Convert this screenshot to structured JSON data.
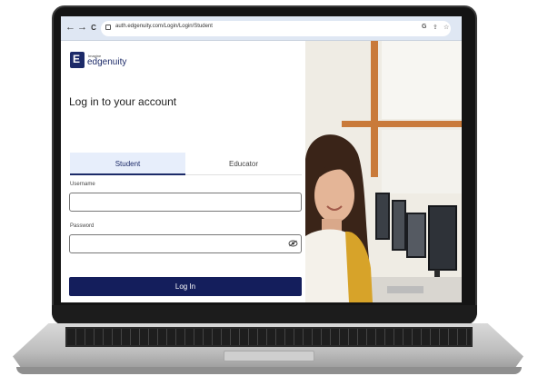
{
  "browser": {
    "url": "auth.edgenuity.com/Login/Login/Student",
    "nav_icons": [
      "back-arrow-icon",
      "forward-arrow-icon",
      "reload-icon"
    ],
    "right_icons": [
      "google-icon",
      "share-icon",
      "star-icon"
    ],
    "back_glyph": "←",
    "forward_glyph": "→",
    "reload_glyph": "C",
    "google_glyph": "G",
    "share_glyph": "⇪",
    "star_glyph": "☆"
  },
  "brand": {
    "small": "Imagine",
    "name": "edgenuity",
    "logo_letter": "E"
  },
  "login": {
    "title": "Log in to your account",
    "tabs": [
      "Student",
      "Educator"
    ],
    "selected_tab": "Student",
    "username_label": "Username",
    "username_value": "",
    "password_label": "Password",
    "password_value": "",
    "submit_label": "Log In"
  },
  "colors": {
    "brand_navy": "#141e5c",
    "tab_selected_bg": "#e7eefb",
    "browser_bar": "#dfe7f3"
  }
}
